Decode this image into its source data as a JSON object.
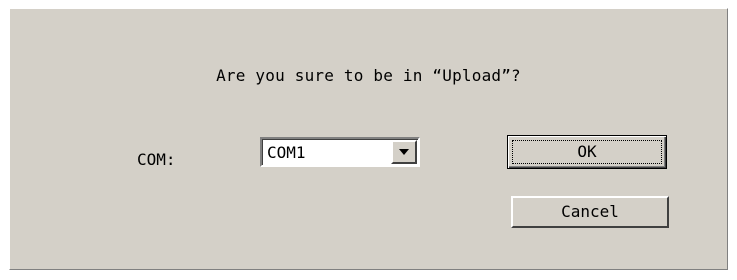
{
  "dialog": {
    "prompt": "Are you sure to be in “Upload”?",
    "com_label": "COM:",
    "com_select": {
      "value": "COM1"
    },
    "ok_label": "OK",
    "cancel_label": "Cancel"
  },
  "icons": {
    "dropdown": "chevron-down-icon"
  },
  "colors": {
    "dialog_background": "#d4d0c8"
  }
}
